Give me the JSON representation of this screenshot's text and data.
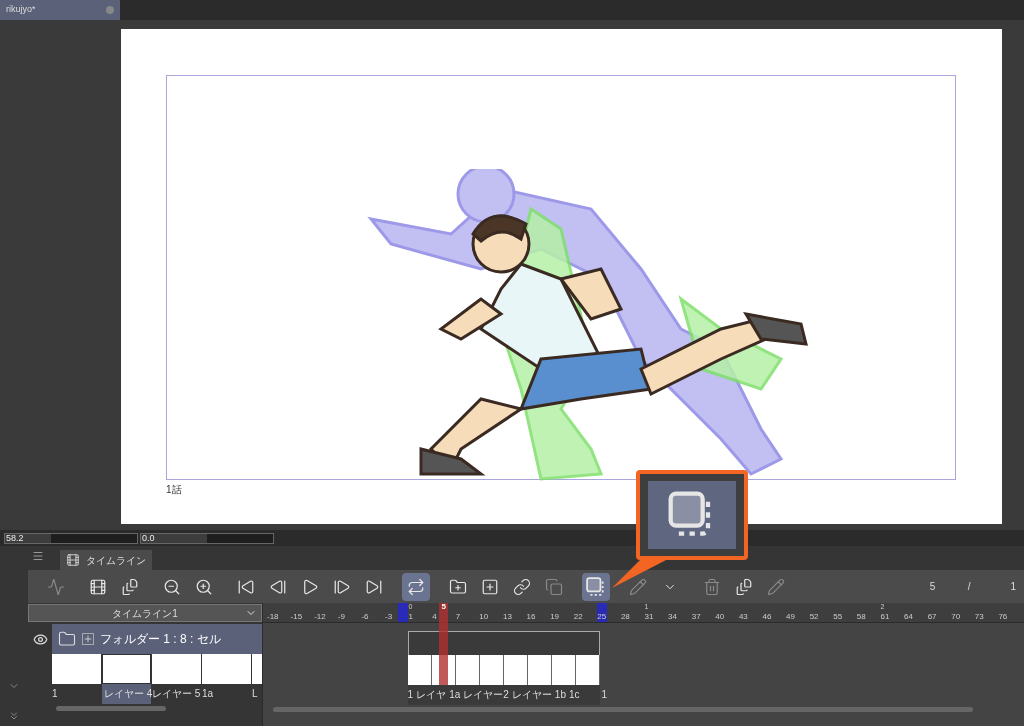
{
  "document_tab": {
    "title": "rikujyo*",
    "selected": true
  },
  "canvas": {
    "episode_label": "1話"
  },
  "status_fields": [
    {
      "value": "58.2",
      "level": 0.35
    },
    {
      "value": "0.0",
      "level": 0.5
    }
  ],
  "panel_tab": {
    "label": "タイムライン",
    "selected": true
  },
  "toolbar": [
    [
      {
        "kind": "graph",
        "active": false,
        "disabled": true
      }
    ],
    [
      {
        "kind": "film",
        "active": false,
        "disabled": false
      },
      {
        "kind": "film-add",
        "active": false,
        "disabled": false
      }
    ],
    [
      {
        "kind": "zoom-out",
        "active": false,
        "disabled": false
      },
      {
        "kind": "zoom-in",
        "active": false,
        "disabled": false
      }
    ],
    [
      {
        "kind": "first",
        "active": false,
        "disabled": false
      },
      {
        "kind": "prev",
        "active": false,
        "disabled": false
      },
      {
        "kind": "play",
        "active": false,
        "disabled": false
      },
      {
        "kind": "next",
        "active": false,
        "disabled": false
      },
      {
        "kind": "last",
        "active": false,
        "disabled": false
      }
    ],
    [
      {
        "kind": "loop",
        "active": true,
        "disabled": false
      }
    ],
    [
      {
        "kind": "folder-add",
        "active": false,
        "disabled": false
      },
      {
        "kind": "cel-add",
        "active": false,
        "disabled": false
      },
      {
        "kind": "link",
        "active": false,
        "disabled": false
      },
      {
        "kind": "cel-copy",
        "active": false,
        "disabled": true
      }
    ],
    [
      {
        "kind": "onion",
        "active": true,
        "disabled": false
      }
    ],
    [
      {
        "kind": "edit",
        "active": false,
        "disabled": true
      },
      {
        "kind": "chevron",
        "active": false,
        "disabled": false
      }
    ],
    [
      {
        "kind": "delete",
        "active": false,
        "disabled": true
      },
      {
        "kind": "frame",
        "active": false,
        "disabled": false
      },
      {
        "kind": "pencil",
        "active": false,
        "disabled": true
      }
    ]
  ],
  "frame_counter": {
    "current": "5",
    "separator": "/",
    "total": "1"
  },
  "timeline_select": {
    "value": "タイムライン1"
  },
  "ruler": [
    {
      "label": "-18"
    },
    {
      "label": "-15"
    },
    {
      "label": "-12"
    },
    {
      "label": "-9"
    },
    {
      "label": "-6"
    },
    {
      "label": "-3",
      "range_start": true
    },
    {
      "label": "1",
      "second": "0"
    },
    {
      "label": "4",
      "playhead": "5"
    },
    {
      "label": "7"
    },
    {
      "label": "10"
    },
    {
      "label": "13"
    },
    {
      "label": "16"
    },
    {
      "label": "19"
    },
    {
      "label": "22"
    },
    {
      "label": "25",
      "range_end": true
    },
    {
      "label": "28"
    },
    {
      "label": "31",
      "second": "1"
    },
    {
      "label": "34"
    },
    {
      "label": "37"
    },
    {
      "label": "40"
    },
    {
      "label": "43"
    },
    {
      "label": "46"
    },
    {
      "label": "49"
    },
    {
      "label": "52"
    },
    {
      "label": "55"
    },
    {
      "label": "58"
    },
    {
      "label": "61",
      "second": "2"
    },
    {
      "label": "64"
    },
    {
      "label": "67"
    },
    {
      "label": "70"
    },
    {
      "label": "73"
    },
    {
      "label": "76"
    }
  ],
  "layer": {
    "name": "フォルダー 1 : 8 : セル",
    "visible": true,
    "expanded": false,
    "cells": [
      {
        "label": "1",
        "selected": false
      },
      {
        "label": "レイヤー 4",
        "selected": true
      },
      {
        "label": "レイヤー 5",
        "selected": false
      },
      {
        "label": "1a",
        "selected": false
      },
      {
        "label": "L",
        "selected": false
      }
    ]
  },
  "track_cells": [
    "1",
    "レイヤ",
    "1a",
    "レイヤー2",
    "レイヤー",
    "1b",
    "1c"
  ],
  "track_end_label": "1"
}
